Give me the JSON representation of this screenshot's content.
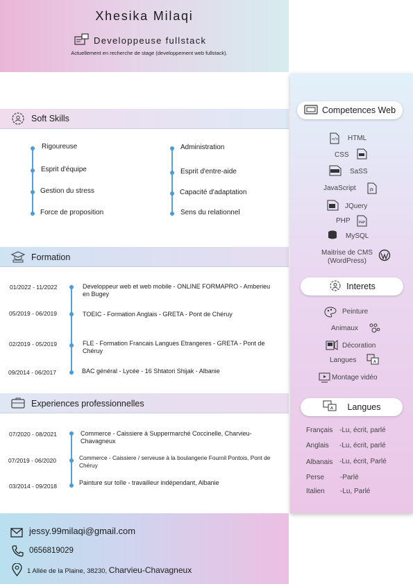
{
  "header": {
    "name": "Xhesika Milaqi",
    "job_title": "Developpeuse fullstack",
    "subtitle": "Actuellement en recherche de stage (developpement web fullstack)."
  },
  "soft_skills": {
    "title": "Soft Skills",
    "left": [
      "Rigoureuse",
      "Esprit d'équipe",
      "Gestion du stress",
      "Force de proposition"
    ],
    "right": [
      "Administration",
      "Esprit d'entre-aide",
      "Capacité d'adaptation",
      "Sens du relationnel"
    ]
  },
  "formation": {
    "title": "Formation",
    "items": [
      {
        "date": "01/2022 - 11/2022",
        "text": "Developpeur web et web mobile - ONLINE FORMAPRO - Amberieu en Bugey"
      },
      {
        "date": "05/2019 - 06/2019",
        "text": "TOEIC - Formation Anglais - GRETA - Pont de Chéruy"
      },
      {
        "date": "02/2019 - 05/2019",
        "text": "FLE - Formation Francais Langues Etrangeres - GRETA - Pont de Chéruy"
      },
      {
        "date": "09/2014 - 06/2017",
        "text": "BAC général - Lycée - 16 Shtatori Shijak - Albanie"
      }
    ]
  },
  "experience": {
    "title": "Experiences professionnelles",
    "items": [
      {
        "date": "07/2020 - 08/2021",
        "text": "Commerce - Caissiere à Suppermarché Coccinelle, Charvieu-Chavagneux"
      },
      {
        "date": "07/2019 - 06/2020",
        "text": "Commerce - Caissiere / serveuse à la boulangerie Fournil Pontois, Pont de Chéruy"
      },
      {
        "date": "03/2014 - 09/2018",
        "text": "Painture sur toîle - travailleur indépendant, Albanie"
      }
    ]
  },
  "competences": {
    "title": "Competences Web",
    "items": [
      "HTML",
      "CSS",
      "SaSS",
      "JavaScript",
      "JQuery",
      "PHP",
      "MySQL",
      "Maitrise de CMS (WordPress)"
    ]
  },
  "interets": {
    "title": "Interets",
    "items": [
      "Peinture",
      "Animaux",
      "Décoration",
      "Langues",
      "Montage vidéo"
    ]
  },
  "langues": {
    "title": "Langues",
    "items": [
      {
        "lang": "Français",
        "level": "-Lu, écrit, parlé"
      },
      {
        "lang": "Anglais",
        "level": "-Lu, écrit, parlé"
      },
      {
        "lang": "Albanais",
        "level": "-Lu, écrit, Parlé"
      },
      {
        "lang": "Perse",
        "level": "-Parlé"
      },
      {
        "lang": "Italien",
        "level": "-Lu, Parlé"
      }
    ]
  },
  "contact": {
    "email": "jessy.99milaqi@gmail.com",
    "phone": "0656819029",
    "address_prefix": "1 Allée de la Plaine, 38230,",
    "address_city": "Charvieu-Chavagneux"
  }
}
